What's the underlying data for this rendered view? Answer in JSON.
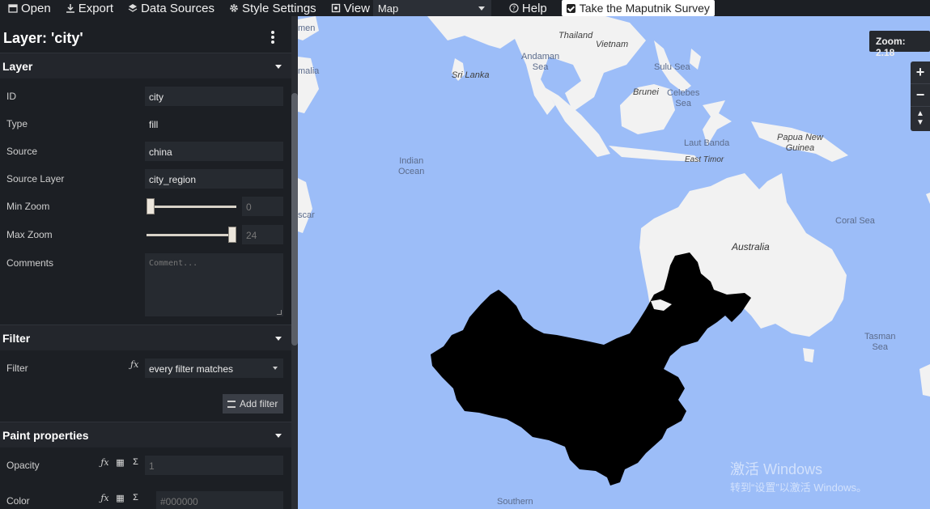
{
  "toolbar": {
    "open": "Open",
    "export": "Export",
    "data_sources": "Data Sources",
    "style_settings": "Style Settings",
    "view": "View",
    "view_selected": "Map",
    "help": "Help",
    "survey": "Take the Maputnik Survey"
  },
  "panel": {
    "layer_title": "Layer: 'city'",
    "sections": {
      "layer": "Layer",
      "filter": "Filter",
      "paint": "Paint properties"
    },
    "fields": {
      "id_label": "ID",
      "id_value": "city",
      "type_label": "Type",
      "type_value": "fill",
      "source_label": "Source",
      "source_value": "china",
      "source_layer_label": "Source Layer",
      "source_layer_value": "city_region",
      "min_zoom_label": "Min Zoom",
      "min_zoom_value": "0",
      "max_zoom_label": "Max Zoom",
      "max_zoom_value": "24",
      "comments_label": "Comments",
      "comments_placeholder": "Comment..."
    },
    "slider_levels": {
      "min_zoom": 0,
      "max_zoom": 24,
      "range_max": 24
    },
    "filter": {
      "label": "Filter",
      "value": "every filter matches",
      "add_button": "Add filter"
    },
    "paint": {
      "opacity_label": "Opacity",
      "opacity_value": "1",
      "color_label": "Color",
      "color_value": "#000000"
    }
  },
  "map": {
    "zoom": "Zoom: 2.18",
    "labels": {
      "thailand": "Thailand",
      "vietnam": "Vietnam",
      "andaman": "Andaman\nSea",
      "sulu": "Sulu Sea",
      "brunei": "Brunei",
      "celebes": "Celebes\nSea",
      "srilanka": "Sri Lanka",
      "indian": "Indian\nOcean",
      "papua": "Papua New\nGuinea",
      "banda": "Laut Banda",
      "easttimor": "East Timor",
      "coral": "Coral Sea",
      "australia": "Australia",
      "tasman": "Tasman\nSea",
      "southern": "Southern",
      "men": "men",
      "malia": "malia",
      "scar": "scar"
    },
    "colors": {
      "water": "#9cbdf8",
      "land": "#f2f2f2",
      "fill": "#000000"
    }
  },
  "watermark": {
    "line1": "激活 Windows",
    "line2": "转到“设置”以激活 Windows。"
  }
}
